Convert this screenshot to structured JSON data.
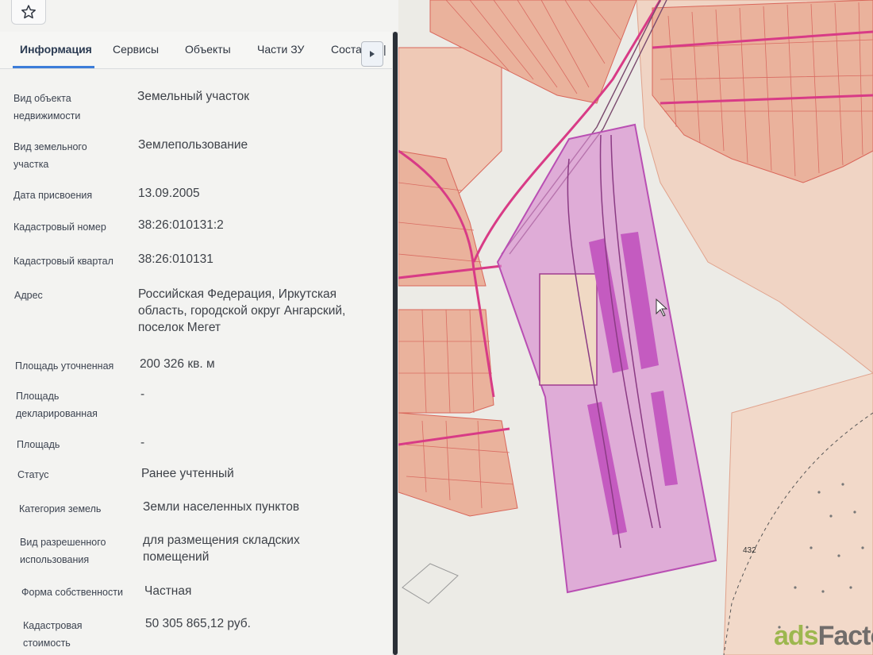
{
  "favorite": {
    "icon": "star-icon"
  },
  "tabs": [
    {
      "label": "Информация"
    },
    {
      "label": "Сервисы"
    },
    {
      "label": "Объекты"
    },
    {
      "label": "Части ЗУ"
    },
    {
      "label": "Соста"
    }
  ],
  "tab_next_icon": "chevron-right-icon",
  "info": {
    "object_type": {
      "label": "Вид объекта недвижимости",
      "value": "Земельный участок"
    },
    "parcel_type": {
      "label": "Вид земельного участка",
      "value": "Землепользование"
    },
    "assign_date": {
      "label": "Дата присвоения",
      "value": "13.09.2005"
    },
    "cadastral_number": {
      "label": "Кадастровый номер",
      "value": "38:26:010131:2"
    },
    "cadastral_quarter": {
      "label": "Кадастровый квартал",
      "value": "38:26:010131"
    },
    "address": {
      "label": "Адрес",
      "value": "Российская Федерация, Иркутская область, городской округ Ангарский, поселок Мегет"
    },
    "area_refined": {
      "label": "Площадь уточненная",
      "value": "200 326 кв. м"
    },
    "area_declared": {
      "label": "Площадь декларированная",
      "value": "-"
    },
    "area": {
      "label": "Площадь",
      "value": "-"
    },
    "status": {
      "label": "Статус",
      "value": "Ранее учтенный"
    },
    "land_category": {
      "label": "Категория земель",
      "value": "Земли населенных пунктов"
    },
    "permitted_use": {
      "label": "Вид разрешенного использования",
      "value": "для размещения складских помещений"
    },
    "ownership": {
      "label": "Форма собственности",
      "value": "Частная"
    },
    "cadastral_value": {
      "label": "Кадастровая стоимость",
      "value": "50 305 865,12 руб."
    }
  },
  "map": {
    "parcel_label": "432",
    "colors": {
      "parcel_fill": "#e8b8a0",
      "parcel_line": "#d9665a",
      "selected": "#c75fc0",
      "road": "#d83b86"
    }
  },
  "watermark": {
    "prefix": "ads",
    "suffix": "Factory"
  }
}
